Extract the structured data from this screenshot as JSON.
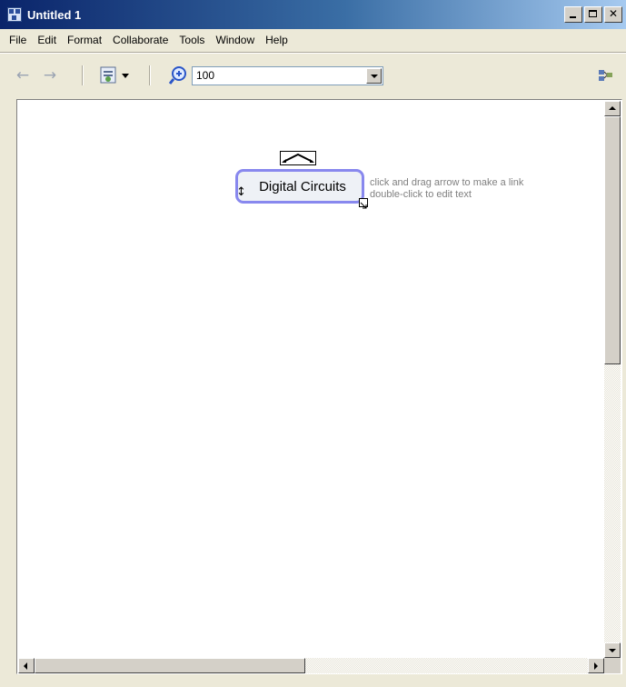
{
  "window": {
    "title": "Untitled 1",
    "close_glyph": "✕"
  },
  "menu": [
    "File",
    "Edit",
    "Format",
    "Collaborate",
    "Tools",
    "Window",
    "Help"
  ],
  "toolbar": {
    "zoom_value": "100"
  },
  "canvas": {
    "node_label": "Digital Circuits",
    "hint_line1": "click and drag arrow to make a link",
    "hint_line2": "double-click to edit text"
  },
  "icons": {
    "back": "←",
    "forward": "→",
    "vresize": "↕",
    "names": [
      "app-icon",
      "back-arrow-icon",
      "forward-arrow-icon",
      "view-icon",
      "zoom-icon",
      "collaborate-icon"
    ]
  },
  "colors": {
    "title_start": "#0a246a",
    "title_end": "#a6caf0",
    "node_border": "#8888ee",
    "hint": "#808080"
  }
}
